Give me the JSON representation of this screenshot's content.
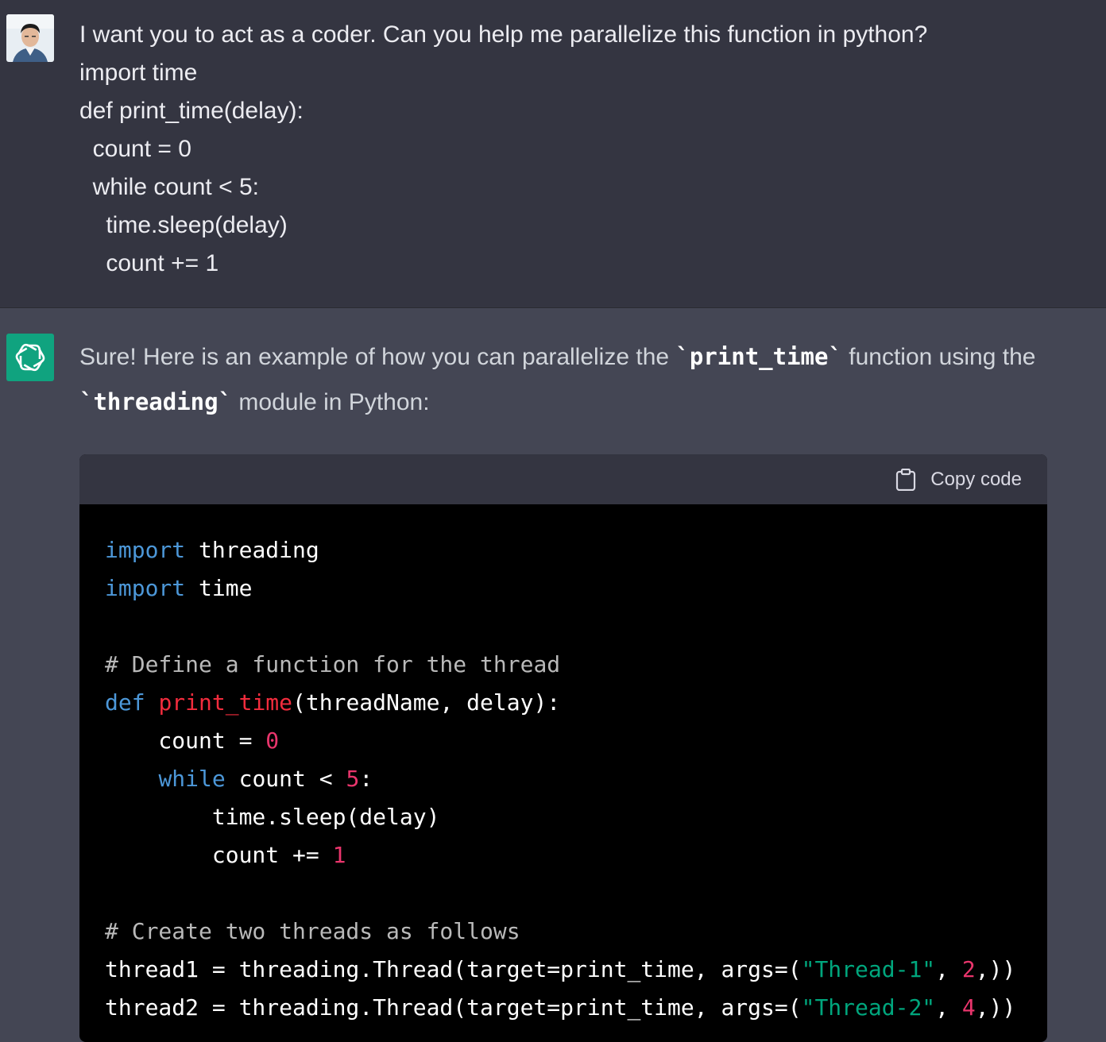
{
  "user_message": {
    "lines": [
      "I want you to act as a coder. Can you help me parallelize this function in python?",
      "import time",
      "def print_time(delay):",
      "  count = 0",
      "  while count < 5:",
      "    time.sleep(delay)",
      "    count += 1"
    ]
  },
  "assistant_message": {
    "intro_part1": "Sure! Here is an example of how you can parallelize the ",
    "intro_code1": "`print_time`",
    "intro_part2": " function using the ",
    "intro_code2": "`threading`",
    "intro_part3": " module in Python:",
    "copy_label": "Copy code",
    "code": {
      "l1_kw": "import",
      "l1_rest": " threading",
      "l2_kw": "import",
      "l2_rest": " time",
      "l4_comment": "# Define a function for the thread",
      "l5_kw": "def",
      "l5_fn": "print_time",
      "l5_rest": "(threadName, delay):",
      "l6_rest": "    count = ",
      "l6_num": "0",
      "l7_ind": "    ",
      "l7_kw": "while",
      "l7_rest": " count < ",
      "l7_num": "5",
      "l7_end": ":",
      "l8_rest": "        time.sleep(delay)",
      "l9_rest": "        count += ",
      "l9_num": "1",
      "l11_comment": "# Create two threads as follows",
      "l12_rest": "thread1 = threading.Thread(target=print_time, args=(",
      "l12_str": "\"Thread-1\"",
      "l12_mid": ", ",
      "l12_num": "2",
      "l12_end": ",))",
      "l13_rest": "thread2 = threading.Thread(target=print_time, args=(",
      "l13_str": "\"Thread-2\"",
      "l13_mid": ", ",
      "l13_num": "4",
      "l13_end": ",))"
    }
  },
  "colors": {
    "user_bg": "#343541",
    "assistant_bg": "#444654",
    "code_bg": "#000000",
    "keyword": "#4c97d8",
    "function": "#f22c3d",
    "number": "#e9356c",
    "string": "#00a67d",
    "brand": "#10a37f"
  },
  "icons": {
    "user_avatar": "user-avatar-photo",
    "assistant_avatar": "openai-logo-icon",
    "copy": "clipboard-icon"
  }
}
